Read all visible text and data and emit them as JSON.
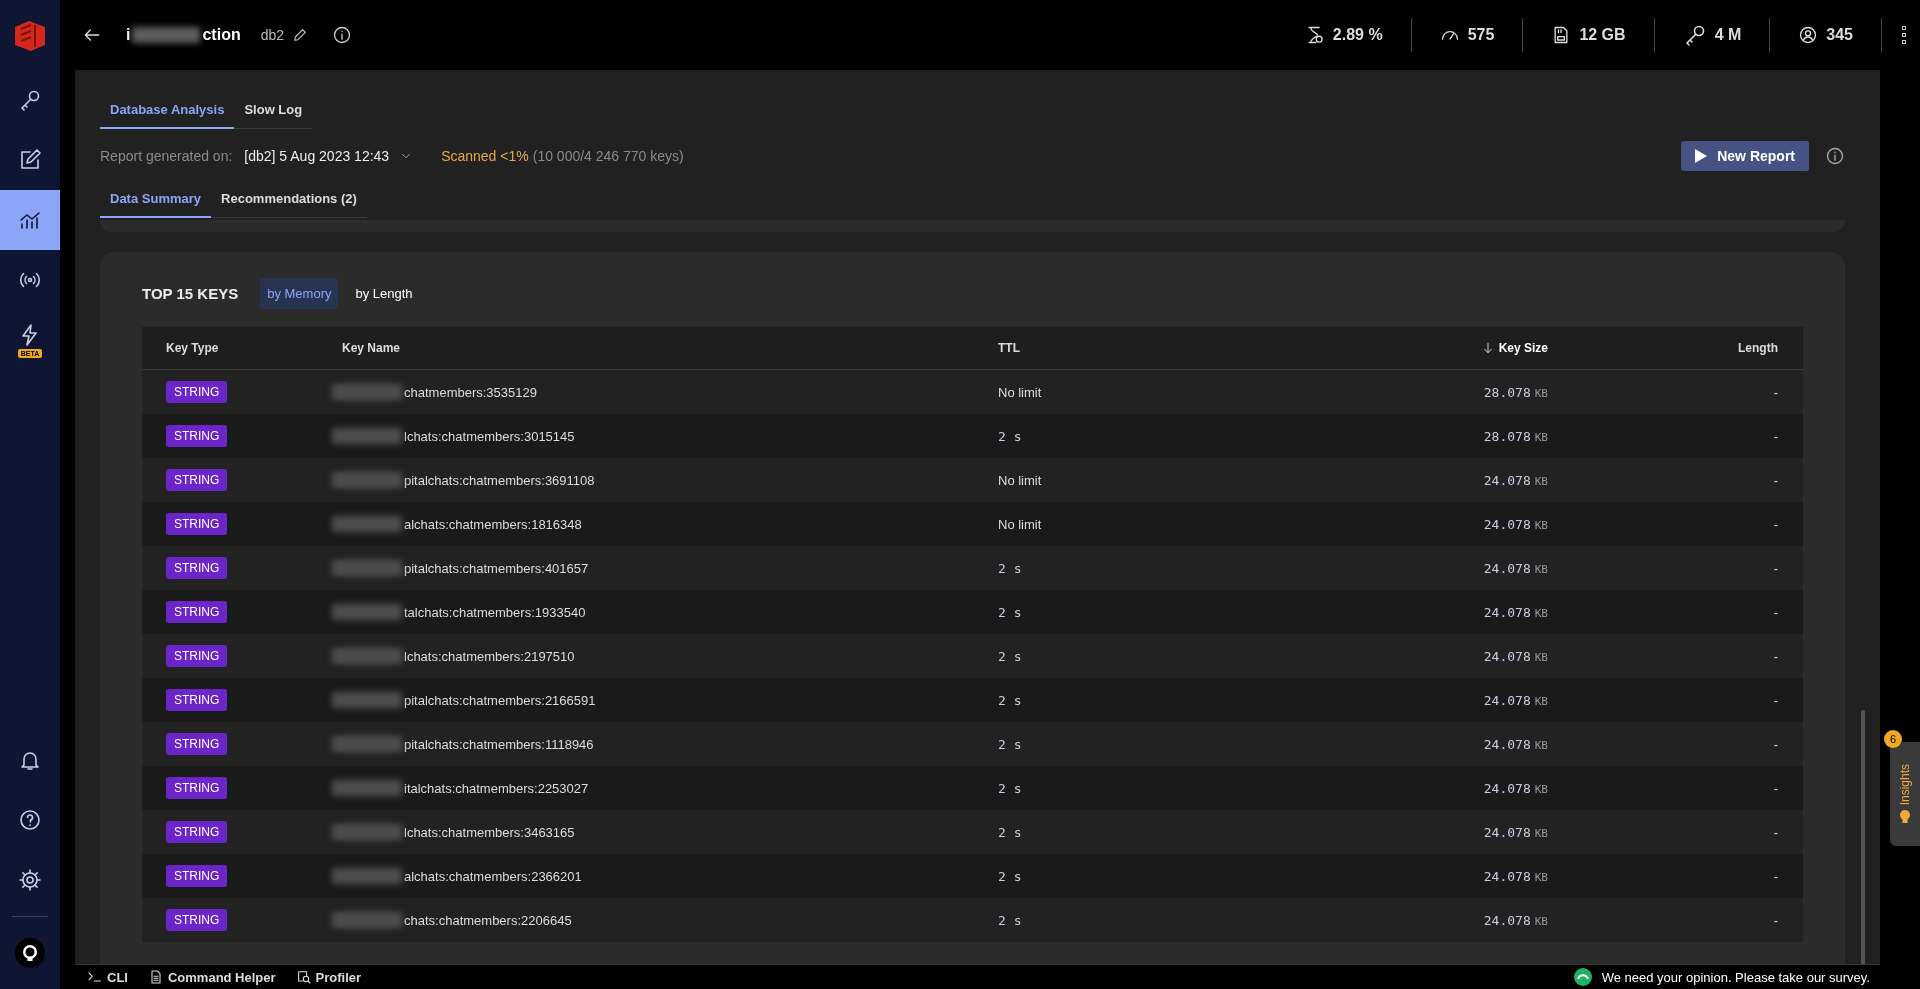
{
  "sidebar": {
    "items": [
      {
        "selected": false
      },
      {
        "selected": false
      },
      {
        "selected": true
      },
      {
        "selected": false
      },
      {
        "selected": false,
        "badge": "BETA"
      }
    ],
    "bottom_items": [
      {
        "selected": false
      },
      {
        "selected": false
      },
      {
        "selected": false
      },
      {
        "selected": false
      }
    ]
  },
  "header": {
    "name_start": "i",
    "name_end": "ction",
    "db_index": "db2"
  },
  "stats": [
    {
      "value": "2.89 %"
    },
    {
      "value": "575"
    },
    {
      "value": "12 GB"
    },
    {
      "value": "4 M"
    },
    {
      "value": "345"
    }
  ],
  "tabs": [
    {
      "label": "Database Analysis",
      "selected": true
    },
    {
      "label": "Slow Log",
      "selected": false
    }
  ],
  "report": {
    "label": "Report generated on:",
    "value": "[db2] 5 Aug 2023 12:43",
    "scanned": "Scanned <1%",
    "scanned_detail": "(10 000/4 246 770 keys)",
    "button": "New Report"
  },
  "subtabs": [
    {
      "label": "Data Summary",
      "selected": true
    },
    {
      "label": "Recommendations (2)",
      "selected": false
    }
  ],
  "top_keys": {
    "title": "TOP 15 KEYS",
    "sort_options": [
      {
        "label": "by Memory",
        "selected": true
      },
      {
        "label": "by Length",
        "selected": false
      }
    ],
    "columns": [
      {
        "label": "Key Type",
        "sorted": false
      },
      {
        "label": "Key Name",
        "sorted": false
      },
      {
        "label": "TTL",
        "sorted": false
      },
      {
        "label": "Key Size",
        "sorted": true
      },
      {
        "label": "Length",
        "sorted": false
      }
    ],
    "rows": [
      {
        "type": "STRING",
        "name": "chatmembers:3535129",
        "ttl": "No limit",
        "size": "28.078",
        "unit": "KB",
        "length": "-"
      },
      {
        "type": "STRING",
        "name": "lchats:chatmembers:3015145",
        "ttl": "2 s",
        "size": "28.078",
        "unit": "KB",
        "length": "-"
      },
      {
        "type": "STRING",
        "name": "pitalchats:chatmembers:3691108",
        "ttl": "No limit",
        "size": "24.078",
        "unit": "KB",
        "length": "-"
      },
      {
        "type": "STRING",
        "name": "alchats:chatmembers:1816348",
        "ttl": "No limit",
        "size": "24.078",
        "unit": "KB",
        "length": "-"
      },
      {
        "type": "STRING",
        "name": "pitalchats:chatmembers:401657",
        "ttl": "2 s",
        "size": "24.078",
        "unit": "KB",
        "length": "-"
      },
      {
        "type": "STRING",
        "name": "talchats:chatmembers:1933540",
        "ttl": "2 s",
        "size": "24.078",
        "unit": "KB",
        "length": "-"
      },
      {
        "type": "STRING",
        "name": "lchats:chatmembers:2197510",
        "ttl": "2 s",
        "size": "24.078",
        "unit": "KB",
        "length": "-"
      },
      {
        "type": "STRING",
        "name": "pitalchats:chatmembers:2166591",
        "ttl": "2 s",
        "size": "24.078",
        "unit": "KB",
        "length": "-"
      },
      {
        "type": "STRING",
        "name": "pitalchats:chatmembers:1118946",
        "ttl": "2 s",
        "size": "24.078",
        "unit": "KB",
        "length": "-"
      },
      {
        "type": "STRING",
        "name": "italchats:chatmembers:2253027",
        "ttl": "2 s",
        "size": "24.078",
        "unit": "KB",
        "length": "-"
      },
      {
        "type": "STRING",
        "name": "lchats:chatmembers:3463165",
        "ttl": "2 s",
        "size": "24.078",
        "unit": "KB",
        "length": "-"
      },
      {
        "type": "STRING",
        "name": "alchats:chatmembers:2366201",
        "ttl": "2 s",
        "size": "24.078",
        "unit": "KB",
        "length": "-"
      },
      {
        "type": "STRING",
        "name": "chats:chatmembers:2206645",
        "ttl": "2 s",
        "size": "24.078",
        "unit": "KB",
        "length": "-"
      }
    ]
  },
  "bottom_bar": {
    "items": [
      {
        "label": "CLI"
      },
      {
        "label": "Command Helper"
      },
      {
        "label": "Profiler"
      }
    ],
    "survey": "We need your opinion. Please take our survey."
  },
  "insights": {
    "label": "Insights",
    "count": "6"
  }
}
